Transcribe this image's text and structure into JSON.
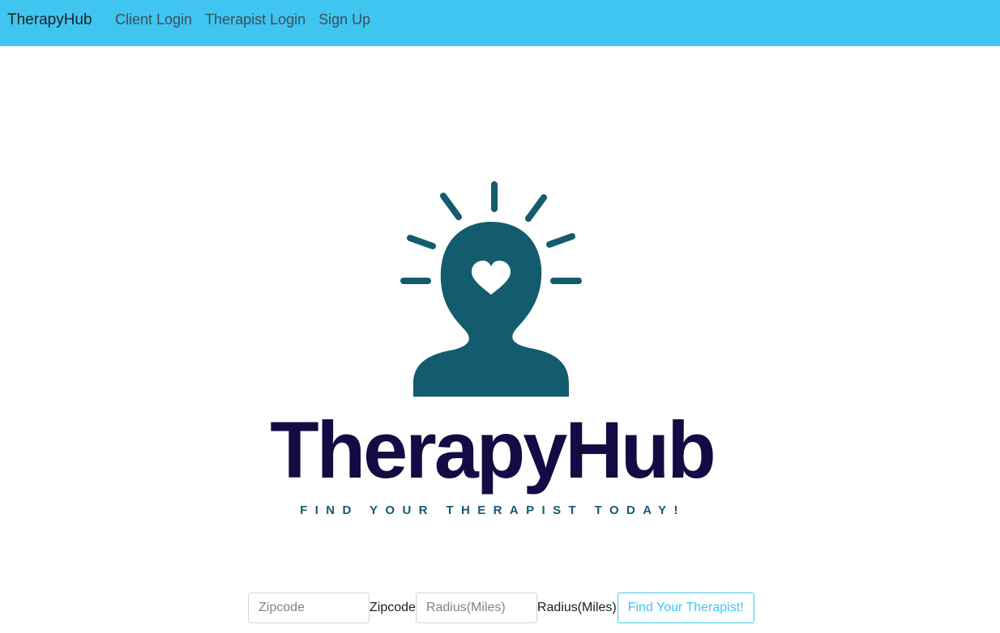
{
  "navbar": {
    "brand": "TherapyHub",
    "links": [
      {
        "label": "Client Login"
      },
      {
        "label": "Therapist Login"
      },
      {
        "label": "Sign Up"
      }
    ]
  },
  "logo": {
    "wordmark": "TherapyHub",
    "tagline": "FIND YOUR THERAPIST TODAY!",
    "icons": [
      "head-silhouette-icon",
      "heart-icon",
      "sunburst-rays-icon"
    ]
  },
  "search": {
    "zip_placeholder": "Zipcode",
    "zip_label": "Zipcode",
    "radius_placeholder": "Radius(Miles)",
    "radius_label": "Radius(Miles)",
    "submit_label": "Find Your Therapist!"
  },
  "colors": {
    "nav_bg": "#3fc5f0",
    "accent": "#3fc5f0",
    "logo_teal": "#135c6e",
    "wordmark_navy": "#140a44"
  }
}
